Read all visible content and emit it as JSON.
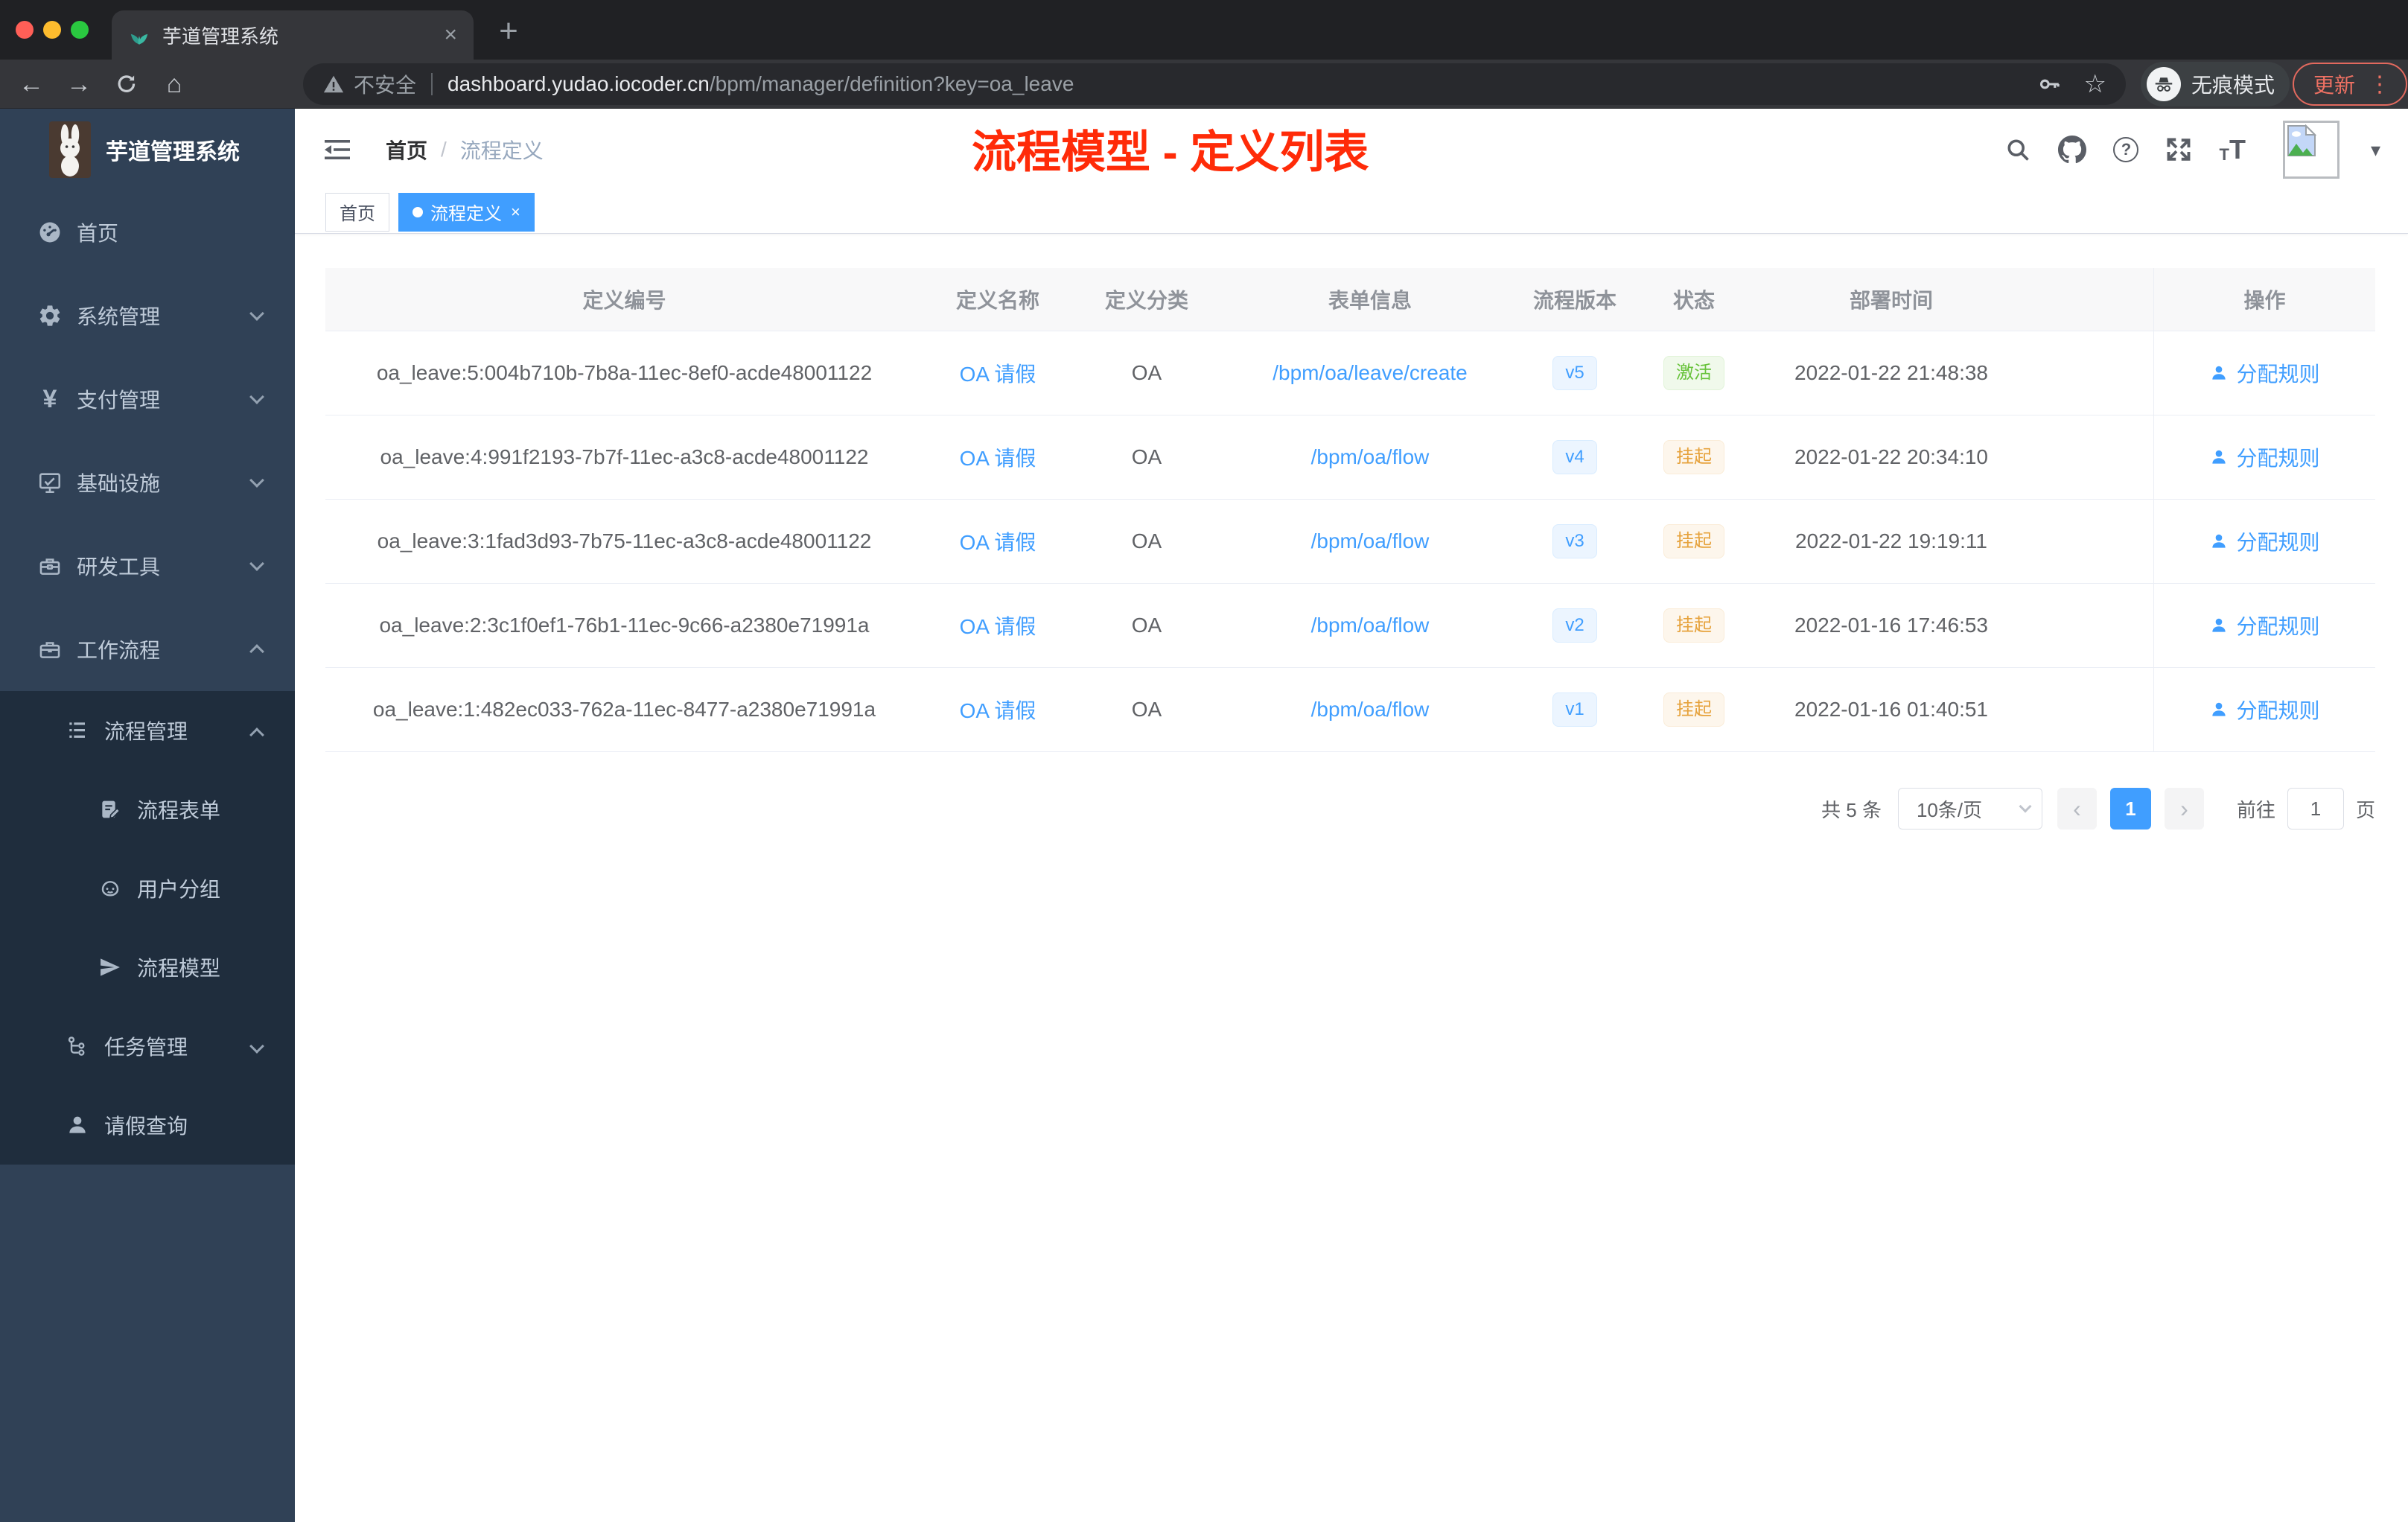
{
  "browser": {
    "tab": {
      "title": "芋道管理系统",
      "close_glyph": "×",
      "new_tab_glyph": "+"
    },
    "toolbar": {
      "back_glyph": "←",
      "forward_glyph": "→",
      "home_glyph": "⌂",
      "security_label": "不安全",
      "url_host": "dashboard.yudao.iocoder.cn",
      "url_path": "/bpm/manager/definition?key=oa_leave",
      "star_glyph": "☆",
      "incognito_label": "无痕模式",
      "update_label": "更新",
      "more_glyph": "⋮"
    }
  },
  "sidebar": {
    "logo_title": "芋道管理系统",
    "items": [
      {
        "label": "首页",
        "icon": "dashboard-icon"
      },
      {
        "label": "系统管理",
        "icon": "gear-icon"
      },
      {
        "label": "支付管理",
        "icon": "yen-icon",
        "yen_glyph": "¥"
      },
      {
        "label": "基础设施",
        "icon": "monitor-icon"
      },
      {
        "label": "研发工具",
        "icon": "toolbox-icon"
      },
      {
        "label": "工作流程",
        "icon": "briefcase-icon"
      }
    ],
    "workflow_submenu": {
      "process_group": {
        "label": "流程管理",
        "icon": "list-icon"
      },
      "children": [
        {
          "label": "流程表单",
          "icon": "form-icon"
        },
        {
          "label": "用户分组",
          "icon": "group-icon"
        },
        {
          "label": "流程模型",
          "icon": "send-icon"
        }
      ],
      "task_group": {
        "label": "任务管理",
        "icon": "tree-icon"
      },
      "leave_query": {
        "label": "请假查询",
        "icon": "user-icon"
      }
    }
  },
  "header": {
    "breadcrumb": {
      "home": "首页",
      "separator": "/",
      "current": "流程定义"
    },
    "annotation": "流程模型 - 定义列表",
    "caret_glyph": "▾"
  },
  "tags": {
    "home": {
      "label": "首页"
    },
    "current": {
      "label": "流程定义",
      "close_glyph": "×"
    }
  },
  "table": {
    "columns": [
      "定义编号",
      "定义名称",
      "定义分类",
      "表单信息",
      "流程版本",
      "状态",
      "部署时间",
      "操作"
    ],
    "action_label": "分配规则",
    "rows": [
      {
        "id": "oa_leave:5:004b710b-7b8a-11ec-8ef0-acde48001122",
        "name": "OA 请假",
        "category": "OA",
        "form": "/bpm/oa/leave/create",
        "version": "v5",
        "status": "激活",
        "time": "2022-01-22 21:48:38"
      },
      {
        "id": "oa_leave:4:991f2193-7b7f-11ec-a3c8-acde48001122",
        "name": "OA 请假",
        "category": "OA",
        "form": "/bpm/oa/flow",
        "version": "v4",
        "status": "挂起",
        "time": "2022-01-22 20:34:10"
      },
      {
        "id": "oa_leave:3:1fad3d93-7b75-11ec-a3c8-acde48001122",
        "name": "OA 请假",
        "category": "OA",
        "form": "/bpm/oa/flow",
        "version": "v3",
        "status": "挂起",
        "time": "2022-01-22 19:19:11"
      },
      {
        "id": "oa_leave:2:3c1f0ef1-76b1-11ec-9c66-a2380e71991a",
        "name": "OA 请假",
        "category": "OA",
        "form": "/bpm/oa/flow",
        "version": "v2",
        "status": "挂起",
        "time": "2022-01-16 17:46:53"
      },
      {
        "id": "oa_leave:1:482ec033-762a-11ec-8477-a2380e71991a",
        "name": "OA 请假",
        "category": "OA",
        "form": "/bpm/oa/flow",
        "version": "v1",
        "status": "挂起",
        "time": "2022-01-16 01:40:51"
      }
    ]
  },
  "pagination": {
    "total": "共 5 条",
    "page_size": "10条/页",
    "prev_glyph": "‹",
    "page": "1",
    "next_glyph": "›",
    "goto_label": "前往",
    "goto_value": "1",
    "goto_suffix": "页"
  },
  "colors": {
    "accent": "#409eff",
    "annotation_red": "#ff2b08",
    "status_active": "#67c23a",
    "status_suspended": "#e6a23c",
    "sidebar_bg": "#304156",
    "submenu_bg": "#1f2d3d"
  }
}
